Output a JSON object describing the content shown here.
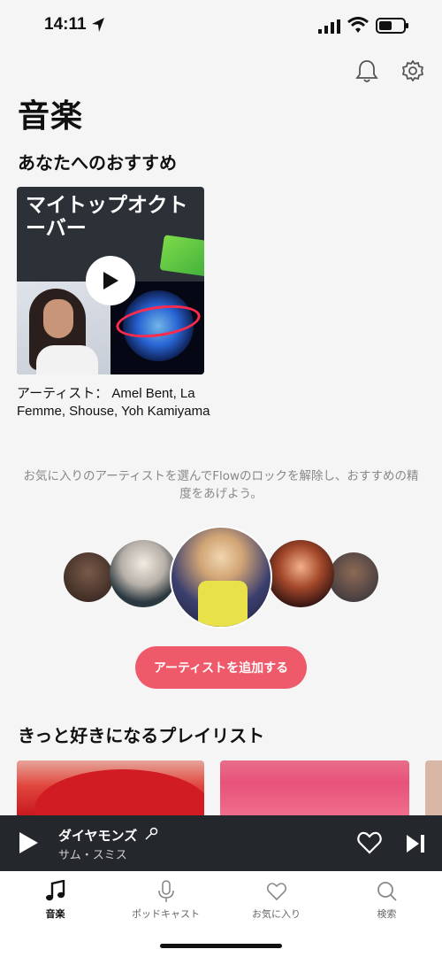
{
  "status_bar": {
    "time": "14:11"
  },
  "page": {
    "title": "音楽"
  },
  "recommended": {
    "section_title": "あなたへのおすすめ",
    "card_title": "マイトップオクトーバー",
    "description": "アーティスト： Amel Bent, La Femme, Shouse, Yoh Kamiyama"
  },
  "unlock": {
    "text": "お気に入りのアーティストを選んでFlowのロックを解除し、おすすめの精度をあげよう。",
    "button_label": "アーティストを追加する"
  },
  "playlists": {
    "section_title": "きっと好きになるプレイリスト"
  },
  "mini_player": {
    "title": "ダイヤモンズ",
    "artist": "サム・スミス"
  },
  "tabs": [
    {
      "label": "音楽",
      "icon": "music-note-icon",
      "active": true
    },
    {
      "label": "ポッドキャスト",
      "icon": "microphone-icon",
      "active": false
    },
    {
      "label": "お気に入り",
      "icon": "heart-icon",
      "active": false
    },
    {
      "label": "検索",
      "icon": "search-icon",
      "active": false
    }
  ],
  "colors": {
    "accent": "#ef5a6a",
    "player_bg": "#24272b",
    "background": "#f5f5f5"
  }
}
